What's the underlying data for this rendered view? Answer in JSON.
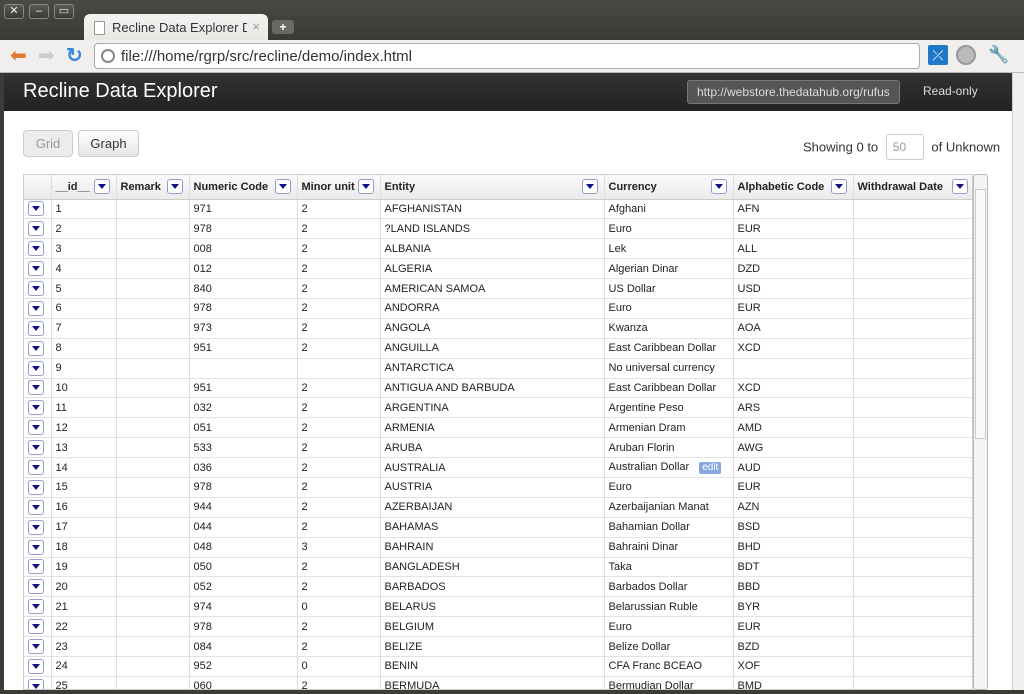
{
  "window": {
    "controls": [
      "close",
      "minimize",
      "maximize"
    ],
    "tab_title": "Recline Data Explorer Der",
    "new_tab_label": "+"
  },
  "browser": {
    "url": "file:///home/rgrp/src/recline/demo/index.html"
  },
  "app": {
    "brand": "Recline Data Explorer",
    "endpoint": "http://webstore.thedatahub.org/rufus",
    "mode": "Read-only",
    "views": [
      {
        "label": "Grid",
        "active": true
      },
      {
        "label": "Graph",
        "active": false
      }
    ],
    "pager": {
      "prefix": "Showing 0 to",
      "size": "50",
      "suffix": "of Unknown"
    }
  },
  "grid": {
    "columns": [
      "__id__",
      "Remark",
      "Numeric Code",
      "Minor unit",
      "Entity",
      "Currency",
      "Alphabetic Code",
      "Withdrawal Date"
    ],
    "edit_label": "edit",
    "rows": [
      [
        "1",
        "",
        "971",
        "2",
        "AFGHANISTAN",
        "Afghani",
        "AFN",
        ""
      ],
      [
        "2",
        "",
        "978",
        "2",
        "?LAND ISLANDS",
        "Euro",
        "EUR",
        ""
      ],
      [
        "3",
        "",
        "008",
        "2",
        "ALBANIA",
        "Lek",
        "ALL",
        ""
      ],
      [
        "4",
        "",
        "012",
        "2",
        "ALGERIA",
        "Algerian Dinar",
        "DZD",
        ""
      ],
      [
        "5",
        "",
        "840",
        "2",
        "AMERICAN SAMOA",
        "US Dollar",
        "USD",
        ""
      ],
      [
        "6",
        "",
        "978",
        "2",
        "ANDORRA",
        "Euro",
        "EUR",
        ""
      ],
      [
        "7",
        "",
        "973",
        "2",
        "ANGOLA",
        "Kwanza",
        "AOA",
        ""
      ],
      [
        "8",
        "",
        "951",
        "2",
        "ANGUILLA",
        "East Caribbean Dollar",
        "XCD",
        ""
      ],
      [
        "9",
        "",
        "",
        "",
        "ANTARCTICA",
        "No universal currency",
        "",
        ""
      ],
      [
        "10",
        "",
        "951",
        "2",
        "ANTIGUA AND BARBUDA",
        "East Caribbean Dollar",
        "XCD",
        ""
      ],
      [
        "11",
        "",
        "032",
        "2",
        "ARGENTINA",
        "Argentine Peso",
        "ARS",
        ""
      ],
      [
        "12",
        "",
        "051",
        "2",
        "ARMENIA",
        "Armenian Dram",
        "AMD",
        ""
      ],
      [
        "13",
        "",
        "533",
        "2",
        "ARUBA",
        "Aruban Florin",
        "AWG",
        ""
      ],
      [
        "14",
        "",
        "036",
        "2",
        "AUSTRALIA",
        "Australian Dollar",
        "AUD",
        ""
      ],
      [
        "15",
        "",
        "978",
        "2",
        "AUSTRIA",
        "Euro",
        "EUR",
        ""
      ],
      [
        "16",
        "",
        "944",
        "2",
        "AZERBAIJAN",
        "Azerbaijanian Manat",
        "AZN",
        ""
      ],
      [
        "17",
        "",
        "044",
        "2",
        "BAHAMAS",
        "Bahamian Dollar",
        "BSD",
        ""
      ],
      [
        "18",
        "",
        "048",
        "3",
        "BAHRAIN",
        "Bahraini Dinar",
        "BHD",
        ""
      ],
      [
        "19",
        "",
        "050",
        "2",
        "BANGLADESH",
        "Taka",
        "BDT",
        ""
      ],
      [
        "20",
        "",
        "052",
        "2",
        "BARBADOS",
        "Barbados Dollar",
        "BBD",
        ""
      ],
      [
        "21",
        "",
        "974",
        "0",
        "BELARUS",
        "Belarussian Ruble",
        "BYR",
        ""
      ],
      [
        "22",
        "",
        "978",
        "2",
        "BELGIUM",
        "Euro",
        "EUR",
        ""
      ],
      [
        "23",
        "",
        "084",
        "2",
        "BELIZE",
        "Belize Dollar",
        "BZD",
        ""
      ],
      [
        "24",
        "",
        "952",
        "0",
        "BENIN",
        "CFA Franc BCEAO",
        "XOF",
        ""
      ],
      [
        "25",
        "",
        "060",
        "2",
        "BERMUDA",
        "Bermudian Dollar",
        "BMD",
        ""
      ]
    ],
    "hover_row_index": 13,
    "hover_col_index": 5
  }
}
